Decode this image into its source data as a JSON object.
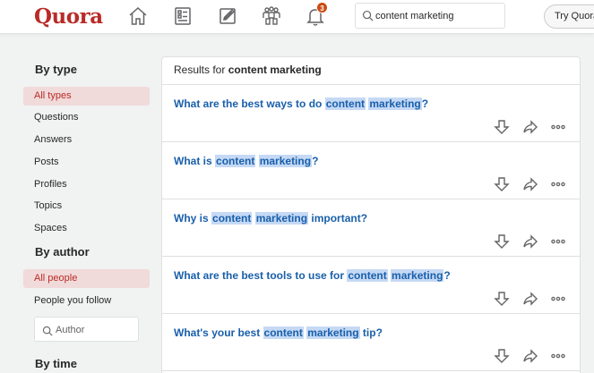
{
  "header": {
    "logo": "Quora",
    "notification_count": "3",
    "search_value": "content marketing",
    "try_button": "Try Quora+",
    "nav_icons": [
      "home-icon",
      "following-icon",
      "answer-icon",
      "spaces-icon",
      "notifications-icon"
    ]
  },
  "sidebar": {
    "by_type_heading": "By type",
    "type_items": [
      "All types",
      "Questions",
      "Answers",
      "Posts",
      "Profiles",
      "Topics",
      "Spaces"
    ],
    "by_author_heading": "By author",
    "author_items": [
      "All people",
      "People you follow"
    ],
    "author_placeholder": "Author",
    "by_time_heading": "By time"
  },
  "results": {
    "prefix": "Results for ",
    "query": "content marketing",
    "items": [
      {
        "parts": [
          "What are the best ways to do ",
          "content",
          " ",
          "marketing",
          "?"
        ]
      },
      {
        "parts": [
          "What is ",
          "content",
          " ",
          "marketing",
          "?"
        ]
      },
      {
        "parts": [
          "Why is ",
          "content",
          " ",
          "marketing",
          " important?"
        ]
      },
      {
        "parts": [
          "What are the best tools to use for ",
          "content",
          " ",
          "marketing",
          "?"
        ]
      },
      {
        "parts": [
          "What's your best ",
          "content",
          " ",
          "marketing",
          " tip?"
        ]
      }
    ]
  },
  "colors": {
    "brand": "#b92b27",
    "link": "#195faa",
    "highlight": "#c5d9f5",
    "active_bg": "#f1dada"
  }
}
